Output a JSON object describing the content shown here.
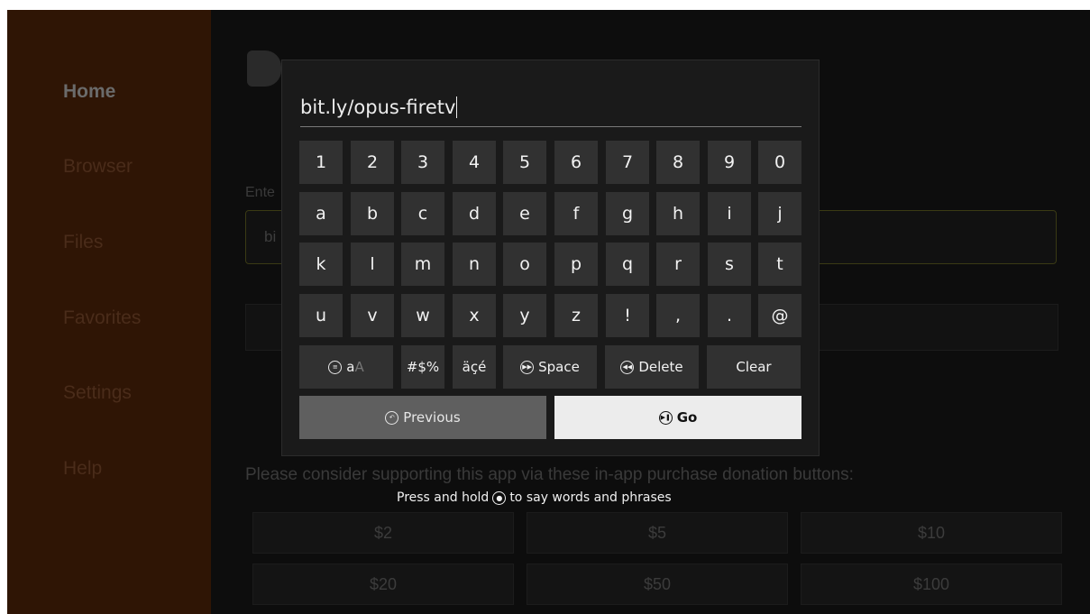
{
  "sidebar": {
    "items": [
      {
        "label": "Home",
        "active": true
      },
      {
        "label": "Browser"
      },
      {
        "label": "Files"
      },
      {
        "label": "Favorites"
      },
      {
        "label": "Settings"
      },
      {
        "label": "Help"
      }
    ]
  },
  "main": {
    "enter_label_partial": "Ente",
    "url_box_partial": "bi",
    "donation_text": "Please consider supporting this app via these in-app purchase donation buttons:",
    "donations": [
      "$2",
      "$5",
      "$10",
      "$20",
      "$50",
      "$100"
    ]
  },
  "keyboard": {
    "entry_text": "bit.ly/opus-firetv",
    "rows": [
      [
        "1",
        "2",
        "3",
        "4",
        "5",
        "6",
        "7",
        "8",
        "9",
        "0"
      ],
      [
        "a",
        "b",
        "c",
        "d",
        "e",
        "f",
        "g",
        "h",
        "i",
        "j"
      ],
      [
        "k",
        "l",
        "m",
        "n",
        "o",
        "p",
        "q",
        "r",
        "s",
        "t"
      ],
      [
        "u",
        "v",
        "w",
        "x",
        "y",
        "z",
        "!",
        ",",
        ".",
        "@"
      ]
    ],
    "case_key": {
      "lower": "a",
      "upper": "A"
    },
    "symbols_label": "#$%",
    "accents_label": "äçé",
    "space_label": "Space",
    "delete_label": "Delete",
    "clear_label": "Clear",
    "previous_label": "Previous",
    "go_label": "Go"
  },
  "hint": {
    "before": "Press and hold",
    "after": "to say words and phrases"
  },
  "colors": {
    "sidebar_bg": "#2f1505",
    "panel_bg": "#1a1a1a",
    "key_bg": "#313131",
    "go_bg": "#ececec",
    "previous_bg": "#5f5f5f"
  }
}
